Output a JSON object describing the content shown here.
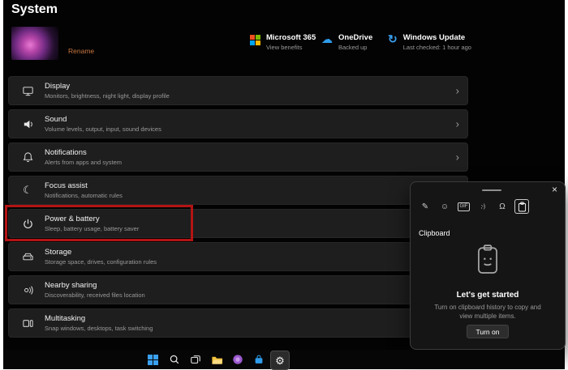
{
  "page": {
    "title": "System"
  },
  "device": {
    "rename": "Rename"
  },
  "status": [
    {
      "title": "Microsoft 365",
      "subtitle": "View benefits"
    },
    {
      "title": "OneDrive",
      "subtitle": "Backed up"
    },
    {
      "title": "Windows Update",
      "subtitle": "Last checked: 1 hour ago"
    }
  ],
  "settings": [
    {
      "title": "Display",
      "subtitle": "Monitors, brightness, night light, display profile"
    },
    {
      "title": "Sound",
      "subtitle": "Volume levels, output, input, sound devices"
    },
    {
      "title": "Notifications",
      "subtitle": "Alerts from apps and system"
    },
    {
      "title": "Focus assist",
      "subtitle": "Notifications, automatic rules"
    },
    {
      "title": "Power & battery",
      "subtitle": "Sleep, battery usage, battery saver"
    },
    {
      "title": "Storage",
      "subtitle": "Storage space, drives, configuration rules"
    },
    {
      "title": "Nearby sharing",
      "subtitle": "Discoverability, received files location"
    },
    {
      "title": "Multitasking",
      "subtitle": "Snap windows, desktops, task switching"
    }
  ],
  "clipboard_panel": {
    "label": "Clipboard",
    "heading": "Let's get started",
    "description": "Turn on clipboard history to copy and view multiple items.",
    "button": "Turn on"
  },
  "icons": {
    "chevron": "›",
    "close": "×",
    "gear": "⚙",
    "moon": "☾",
    "pen": "✎",
    "smiley": "☺",
    "cloud": "☁",
    "update": "↻",
    "gif": "GIF",
    "kaomoji": ";-)",
    "symbols": "Ω"
  },
  "colors": {
    "annotation_red": "#b41414",
    "rename_accent": "#c8763f",
    "card_bg": "#1e1e1e",
    "ms_red": "#f25022",
    "ms_green": "#7fba00",
    "ms_blue": "#00a4ef",
    "ms_yellow": "#ffb900",
    "onedrive_blue": "#2f9ceb",
    "update_blue": "#3aa0f0"
  }
}
